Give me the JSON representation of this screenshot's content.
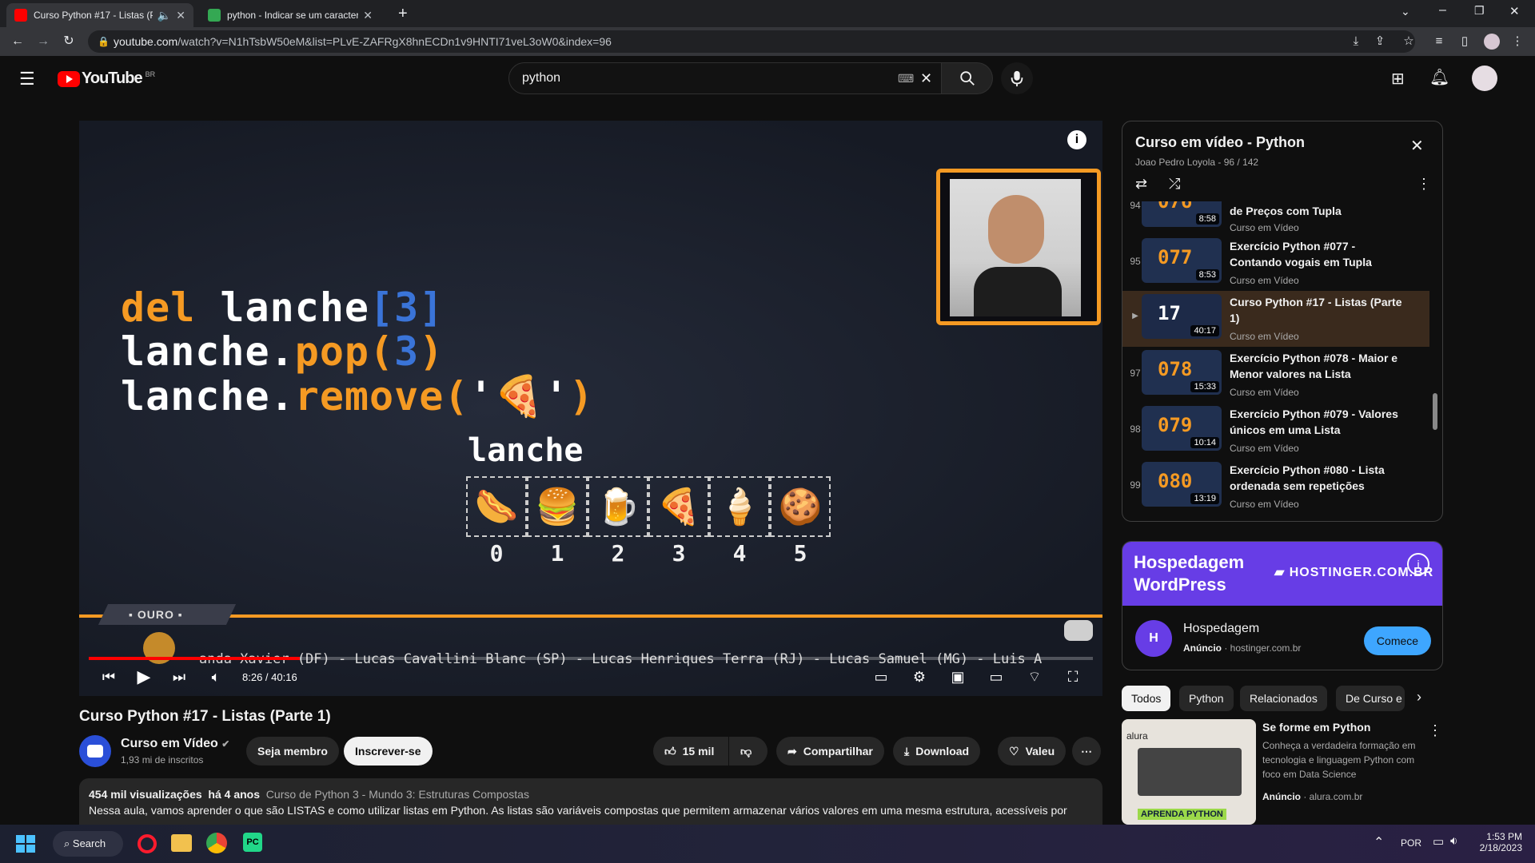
{
  "browser": {
    "tabs": [
      {
        "title": "Curso Python #17 - Listas (Pa",
        "favicon_color": "#ff0000",
        "active": true
      },
      {
        "title": "python - Indicar se um caractere",
        "favicon_color": "#34a853",
        "active": false
      }
    ],
    "new_tab": "+",
    "url_host": "youtube.com",
    "url_path": "/watch?v=N1hTsbW50eM&list=PLvE-ZAFRgX8hnECDn1v9HNTI71veL3oW0&index=96"
  },
  "header": {
    "logo_text": "YouTube",
    "country": "BR",
    "search_value": "python"
  },
  "video": {
    "code_line1_a": "del ",
    "code_line1_b": "lanche",
    "code_line1_c": "[3]",
    "code_line2_a": "lanche.",
    "code_line2_b": "pop(",
    "code_line2_c": "3",
    "code_line2_d": ")",
    "code_line3_a": "lanche.",
    "code_line3_b": "remove(",
    "code_line3_c": "'🍕'",
    "code_line3_d": ")",
    "list_label": "lanche",
    "foods": [
      {
        "icon": "🌭",
        "idx": "0"
      },
      {
        "icon": "🍔",
        "idx": "1"
      },
      {
        "icon": "🍺",
        "idx": "2"
      },
      {
        "icon": "🍕",
        "idx": "3"
      },
      {
        "icon": "🍦",
        "idx": "4"
      },
      {
        "icon": "🍪",
        "idx": "5"
      }
    ],
    "badge": "OURO",
    "ticker": "anda Xavier (DF) - Lucas Cavallini Blanc (SP) - Lucas Henriques Terra (RJ) - Lucas Samuel (MG) - Luis A",
    "time": "8:26 / 40:16",
    "progress": 0.21
  },
  "meta": {
    "title": "Curso Python #17 - Listas (Parte 1)",
    "channel": "Curso em Vídeo",
    "subscribers": "1,93 mi de inscritos",
    "member_label": "Seja membro",
    "subscribe_label": "Inscrever-se",
    "likes": "15 mil",
    "share_label": "Compartilhar",
    "download_label": "Download",
    "thanks_label": "Valeu",
    "views": "454 mil visualizações",
    "age": "há 4 anos",
    "tags": "Curso de Python 3 - Mundo 3: Estruturas Compostas",
    "description": "Nessa aula, vamos aprender o que são LISTAS e como utilizar listas em Python. As listas são variáveis compostas que permitem armazenar vários valores em uma mesma estrutura, acessíveis por"
  },
  "playlist": {
    "title": "Curso em vídeo - Python",
    "owner": "Joao Pedro Loyola - 96 / 142",
    "items": [
      {
        "idx": "94",
        "num": "076",
        "title": "de Preços com Tupla",
        "channel": "Curso em Vídeo",
        "duration": "8:58"
      },
      {
        "idx": "95",
        "num": "077",
        "title": "Exercício Python #077 - Contando vogais em Tupla",
        "channel": "Curso em Vídeo",
        "duration": "8:53"
      },
      {
        "idx": "▶",
        "num": "17",
        "title": "Curso Python #17 - Listas (Parte 1)",
        "channel": "Curso em Vídeo",
        "duration": "40:17"
      },
      {
        "idx": "97",
        "num": "078",
        "title": "Exercício Python #078 - Maior e Menor valores na Lista",
        "channel": "Curso em Vídeo",
        "duration": "15:33"
      },
      {
        "idx": "98",
        "num": "079",
        "title": "Exercício Python #079 - Valores únicos em uma Lista",
        "channel": "Curso em Vídeo",
        "duration": "10:14"
      },
      {
        "idx": "99",
        "num": "080",
        "title": "Exercício Python #080 - Lista ordenada sem repetições",
        "channel": "Curso em Vídeo",
        "duration": "13:19"
      }
    ]
  },
  "ad": {
    "banner_line1": "Hospedagem",
    "banner_line2": "WordPress",
    "brand": "HOSTINGER.COM.BR",
    "name": "Hospedagem",
    "label": "Anúncio",
    "domain": "hostinger.com.br",
    "cta": "Comece"
  },
  "chips": [
    "Todos",
    "Python",
    "Relacionados",
    "De Curso e"
  ],
  "sponsored": {
    "title": "Se forme em Python",
    "desc": "Conheça a verdadeira formação em tecnologia e linguagem Python com foco em Data Science",
    "label": "Anúncio",
    "domain": "alura.com.br",
    "thumb_brand": "alura",
    "thumb_caption": "APRENDA PYTHON"
  },
  "taskbar": {
    "search": "Search",
    "lang": "POR",
    "time": "1:53 PM",
    "date": "2/18/2023"
  }
}
